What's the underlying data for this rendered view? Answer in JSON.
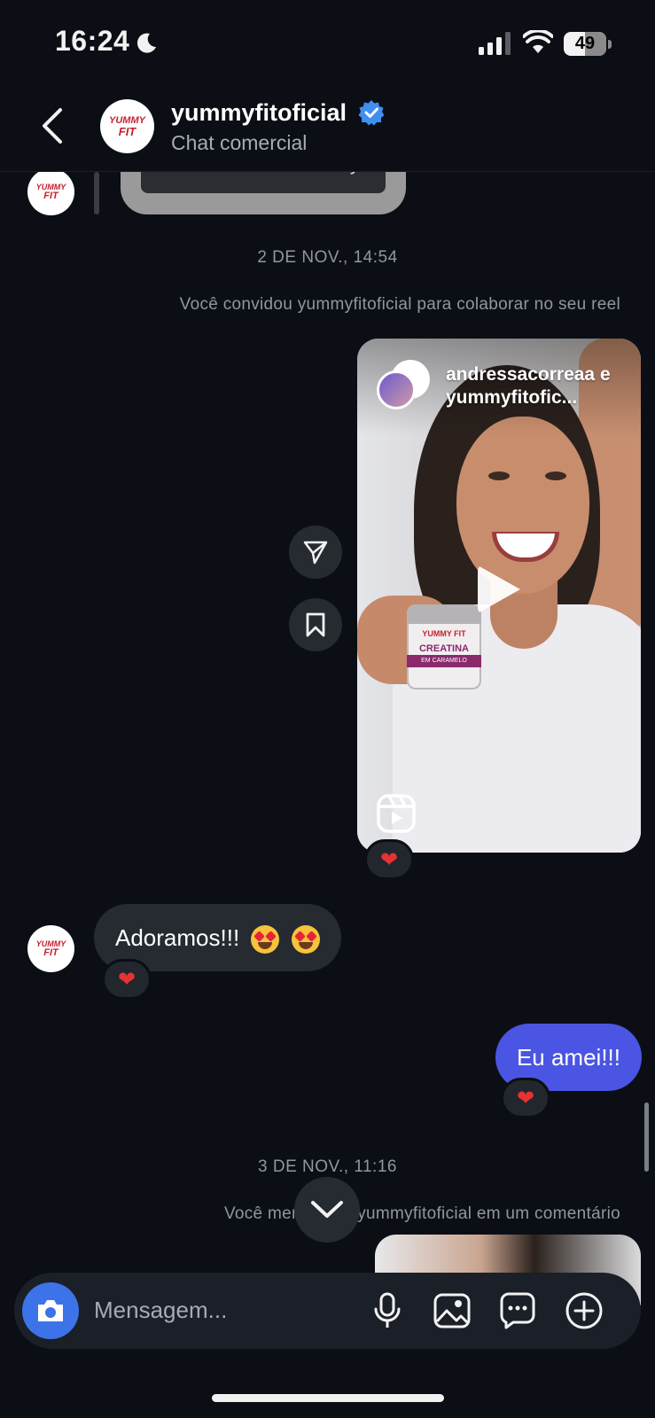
{
  "status_bar": {
    "time": "16:24",
    "battery": "49"
  },
  "header": {
    "name": "yummyfitoficial",
    "subtitle": "Chat comercial"
  },
  "avatar_logo": {
    "line1": "YUMMY",
    "line2": "FIT"
  },
  "story_partial": {
    "button_label": "Adicionar ao seu story"
  },
  "thread": {
    "timestamp1": "2 DE NOV., 14:54",
    "system1": "Você convidou yummyfitoficial para colaborar no seu reel",
    "reel": {
      "title": "andressacorreaa e yummyfitofic...",
      "jar_brand": "YUMMY FIT",
      "jar_name": "CREATINA",
      "jar_band": "EM CARAMELO"
    },
    "reaction_heart": "❤",
    "incoming_message": "Adoramos!!!",
    "outgoing_message": "Eu amei!!!",
    "timestamp2": "3 DE NOV., 11:16",
    "system2": "Você mencionou yummyfitoficial em um comentário"
  },
  "composer": {
    "placeholder": "Mensagem..."
  },
  "colors": {
    "background": "#0b0e14",
    "bubble_incoming": "#262a31",
    "bubble_outgoing": "#4b55e3",
    "camera_button": "#3d73e8",
    "verified_badge": "#3f8ef0",
    "heart": "#e53232"
  },
  "icons": [
    "moon-icon",
    "signal-icon",
    "wifi-icon",
    "battery-icon",
    "back-chevron-icon",
    "verified-badge-icon",
    "send-icon",
    "bookmark-icon",
    "play-icon",
    "reels-icon",
    "chevron-down-icon",
    "camera-icon",
    "microphone-icon",
    "gallery-icon",
    "chat-bubble-icon",
    "plus-circle-icon"
  ]
}
